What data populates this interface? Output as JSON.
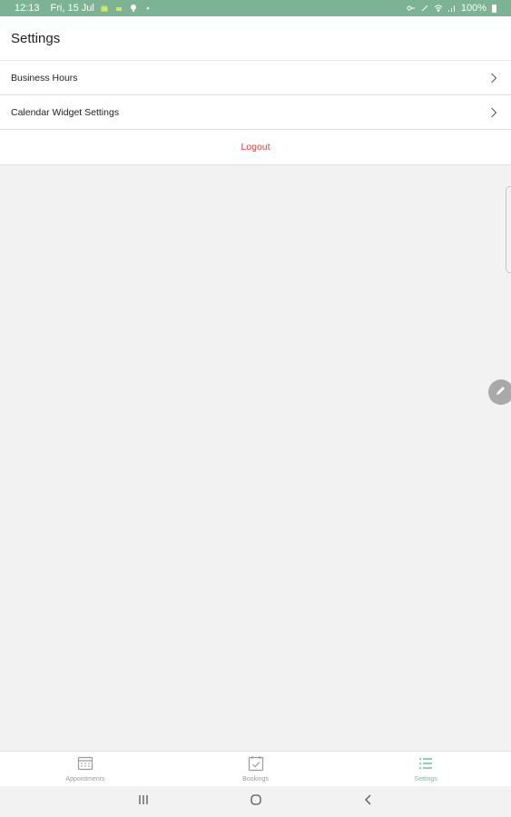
{
  "status_bar": {
    "time": "12:13",
    "date": "Fri, 15 Jul",
    "battery": "100%",
    "background": "#7bb394"
  },
  "header": {
    "title": "Settings"
  },
  "settings_items": [
    {
      "label": "Business Hours",
      "icon": "chevron-right-icon"
    },
    {
      "label": "Calendar Widget Settings",
      "icon": "chevron-right-icon"
    }
  ],
  "logout": {
    "label": "Logout",
    "color": "#e53935"
  },
  "bottom_nav": {
    "items": [
      {
        "label": "Appointments",
        "icon": "calendar-grid-icon",
        "active": false
      },
      {
        "label": "Bookings",
        "icon": "calendar-check-icon",
        "active": false
      },
      {
        "label": "Settings",
        "icon": "list-icon",
        "active": true
      }
    ],
    "active_color": "#6dbf99",
    "inactive_color": "#9a9a9a"
  },
  "system_nav": {
    "buttons": [
      "recent-apps-icon",
      "home-icon",
      "back-icon"
    ]
  }
}
